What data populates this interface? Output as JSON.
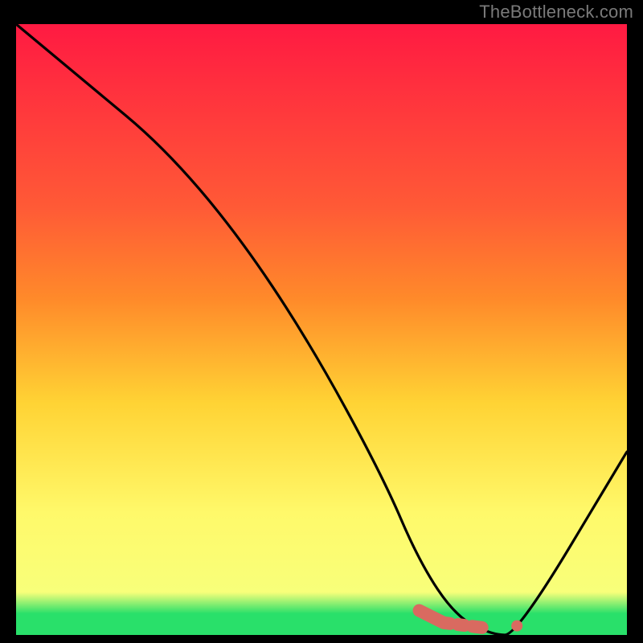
{
  "attribution": "TheBottleneck.com",
  "chart_data": {
    "type": "line",
    "title": "",
    "xlabel": "",
    "ylabel": "",
    "xlim": [
      0,
      100
    ],
    "ylim": [
      0,
      100
    ],
    "series": [
      {
        "name": "curve",
        "x": [
          0,
          12,
          24,
          36,
          48,
          60,
          66,
          72,
          78,
          82,
          100
        ],
        "y": [
          100,
          90,
          80,
          66,
          48,
          26,
          12,
          3,
          0,
          0,
          30
        ]
      },
      {
        "name": "optimal-marker",
        "x": [
          66,
          70,
          74,
          78,
          80,
          82
        ],
        "y": [
          4,
          2,
          1.5,
          1,
          1,
          1.5
        ]
      }
    ],
    "gradient_colors": {
      "top": "#ff1a42",
      "mid1": "#ff8a2a",
      "mid2": "#ffd334",
      "low": "#fff96a",
      "base_yellow": "#f8ff7a",
      "green": "#29e06a"
    },
    "marker_color": "#d96a60",
    "curve_color": "#000000"
  }
}
